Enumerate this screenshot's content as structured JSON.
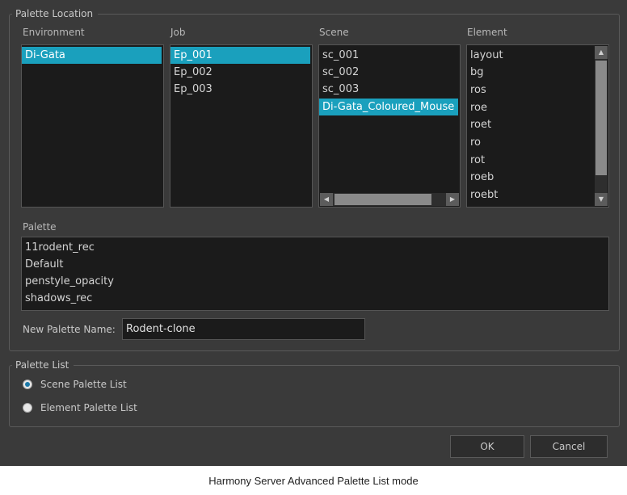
{
  "palette_location": {
    "title": "Palette Location",
    "columns": {
      "environment": {
        "label": "Environment",
        "items": [
          {
            "text": "Di-Gata",
            "selected": true
          }
        ]
      },
      "job": {
        "label": "Job",
        "items": [
          {
            "text": "Ep_001",
            "selected": true
          },
          {
            "text": "Ep_002",
            "selected": false
          },
          {
            "text": "Ep_003",
            "selected": false
          }
        ]
      },
      "scene": {
        "label": "Scene",
        "items": [
          {
            "text": "sc_001",
            "selected": false
          },
          {
            "text": "sc_002",
            "selected": false
          },
          {
            "text": "sc_003",
            "selected": false
          },
          {
            "text": "Di-Gata_Coloured_Mouse",
            "selected": true
          }
        ]
      },
      "element": {
        "label": "Element",
        "items": [
          {
            "text": "layout"
          },
          {
            "text": "bg"
          },
          {
            "text": "ros"
          },
          {
            "text": "roe"
          },
          {
            "text": "roet"
          },
          {
            "text": "ro"
          },
          {
            "text": "rot"
          },
          {
            "text": "roeb"
          },
          {
            "text": "roebt"
          }
        ]
      }
    },
    "palette": {
      "label": "Palette",
      "items": [
        "11rodent_rec",
        "Default",
        "penstyle_opacity",
        "shadows_rec"
      ]
    },
    "new_palette": {
      "label": "New Palette Name:",
      "value": "Rodent-clone"
    }
  },
  "palette_list": {
    "title": "Palette List",
    "options": [
      {
        "label": "Scene Palette List",
        "checked": true
      },
      {
        "label": "Element Palette List",
        "checked": false
      }
    ]
  },
  "buttons": {
    "ok": "OK",
    "cancel": "Cancel"
  },
  "caption": "Harmony Server Advanced Palette List mode",
  "colors": {
    "selection": "#1aa0bd",
    "dialog_bg": "#3a3a3a",
    "list_bg": "#1b1b1b"
  }
}
